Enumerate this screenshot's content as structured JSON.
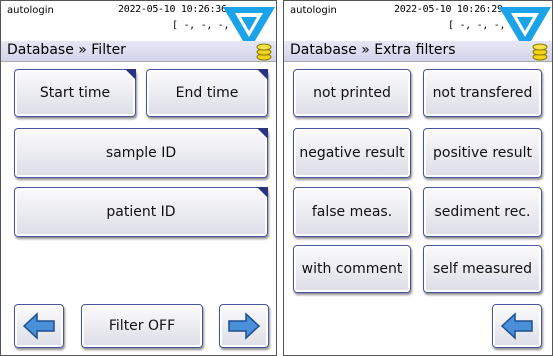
{
  "left_screen": {
    "status": {
      "user": "autologin",
      "datetime": "2022-05-10  10:26:36",
      "coords": "[ -, -, -, 3]"
    },
    "title": "Database » Filter",
    "buttons": {
      "start_time": "Start time",
      "end_time": "End time",
      "sample_id": "sample ID",
      "patient_id": "patient ID",
      "filter_off": "Filter OFF"
    }
  },
  "right_screen": {
    "status": {
      "user": "autologin",
      "datetime": "2022-05-10  10:26:29",
      "coords": "[ -, -, -, 3]"
    },
    "title": "Database » Extra filters",
    "buttons": {
      "not_printed": "not printed",
      "not_transfered": "not transfered",
      "negative_result": "negative result",
      "positive_result": "positive result",
      "false_meas": "false meas.",
      "sediment_rec": "sediment rec.",
      "with_comment": "with comment",
      "self_measured": "self measured"
    }
  },
  "icons": {
    "logo": "triangle-logo-icon",
    "database": "database-icon",
    "back": "left-arrow-icon",
    "forward": "right-arrow-icon"
  },
  "colors": {
    "logo_blue": "#1aa3e8",
    "title_bar": "#dcdcf0",
    "button_border": "#4a55a0",
    "button_corner": "#2a3380",
    "arrow_blue": "#4a90d9",
    "database_yellow": "#f2d21c"
  }
}
